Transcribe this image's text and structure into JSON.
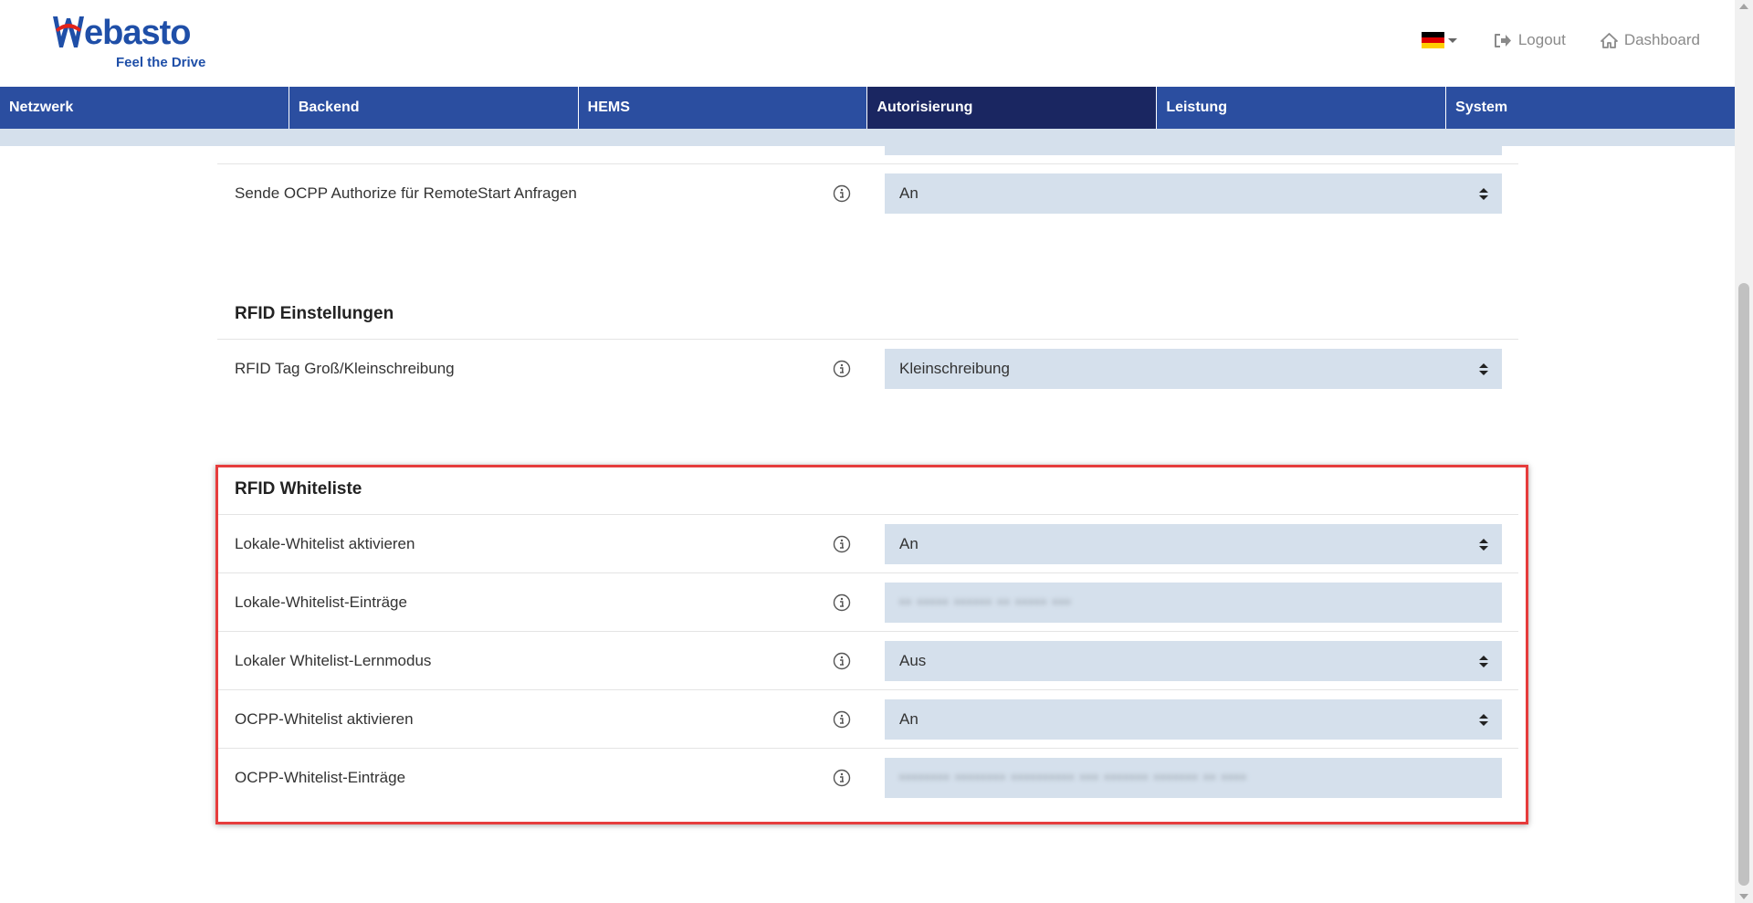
{
  "header": {
    "logo": {
      "word": "ebasto",
      "tagline": "Feel the Drive"
    },
    "language": {
      "current": "de",
      "flag_colors": [
        "#000000",
        "#dd0000",
        "#ffce00"
      ]
    },
    "logout_label": "Logout",
    "dashboard_label": "Dashboard"
  },
  "nav": {
    "items": [
      {
        "label": "Netzwerk"
      },
      {
        "label": "Backend"
      },
      {
        "label": "HEMS"
      },
      {
        "label": "Autorisierung"
      },
      {
        "label": "Leistung"
      },
      {
        "label": "System"
      }
    ],
    "active_index": 3
  },
  "content": {
    "remote_start_row": {
      "label": "Sende OCPP Authorize für RemoteStart Anfragen",
      "value": "An"
    },
    "rfid_settings": {
      "title": "RFID Einstellungen",
      "rows": [
        {
          "label": "RFID Tag Groß/Kleinschreibung",
          "value": "Kleinschreibung"
        }
      ]
    },
    "rfid_whitelist": {
      "title": "RFID Whiteliste",
      "rows": [
        {
          "label": "Lokale-Whitelist aktivieren",
          "value": "An"
        },
        {
          "label": "Lokale-Whitelist-Einträge",
          "value": "•• ••••• •••••• •• ••••• •••"
        },
        {
          "label": "Lokaler Whitelist-Lernmodus",
          "value": "Aus"
        },
        {
          "label": "OCPP-Whitelist aktivieren",
          "value": "An"
        },
        {
          "label": "OCPP-Whitelist-Einträge",
          "value": "•••••••• •••••••• •••••••••• ••• ••••••• ••••••• •• ••••"
        }
      ]
    }
  },
  "colors": {
    "brand_blue": "#1f4fa8",
    "nav_bg": "#2b4ea0",
    "nav_active_bg": "#1a2661",
    "field_bg": "#d5e0ec",
    "highlight_border": "#e63c3c"
  }
}
